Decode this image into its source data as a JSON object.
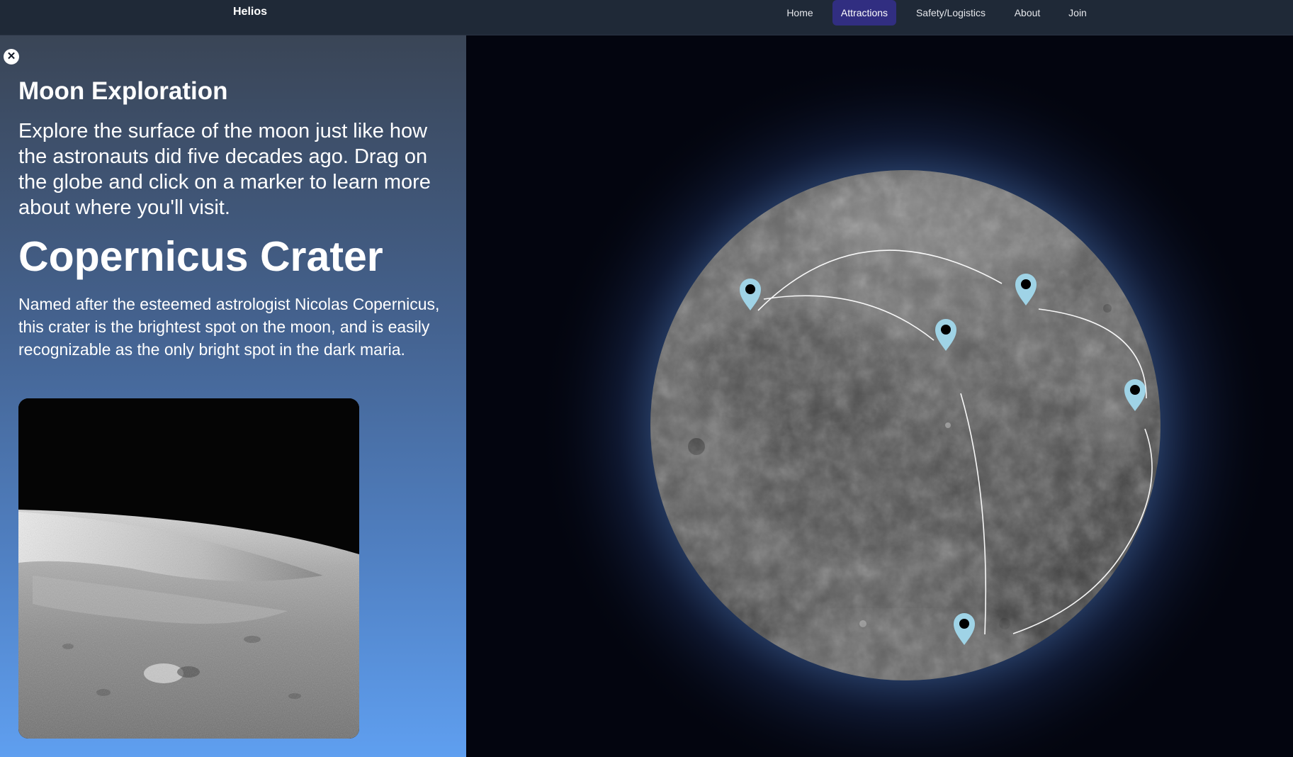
{
  "nav": {
    "brand": "Helios",
    "items": [
      {
        "label": "Home",
        "active": false
      },
      {
        "label": "Attractions",
        "active": true
      },
      {
        "label": "Safety/Logistics",
        "active": false
      },
      {
        "label": "About",
        "active": false
      },
      {
        "label": "Join",
        "active": false
      }
    ]
  },
  "panel": {
    "close_glyph": "✕",
    "title": "Moon Exploration",
    "intro": "Explore the surface of the moon just like how the astronauts did five decades ago. Drag on the globe and click on a marker to learn more about where you'll visit.",
    "site_title": "Copernicus Crater",
    "site_description": "Named after the esteemed astrologist Nicolas Copernicus, this crater is the brightest spot on the moon, and is easily recognizable as the only bright spot in the dark maria."
  },
  "globe": {
    "marker_count": 5,
    "marker_icon": "map-pin-icon"
  },
  "colors": {
    "nav_bg": "#1f2937",
    "nav_active": "#312e81",
    "panel_top": "#3a4556",
    "panel_bottom": "#5f9ff0",
    "marker": "#9fd3e6",
    "space": "#03050f"
  }
}
